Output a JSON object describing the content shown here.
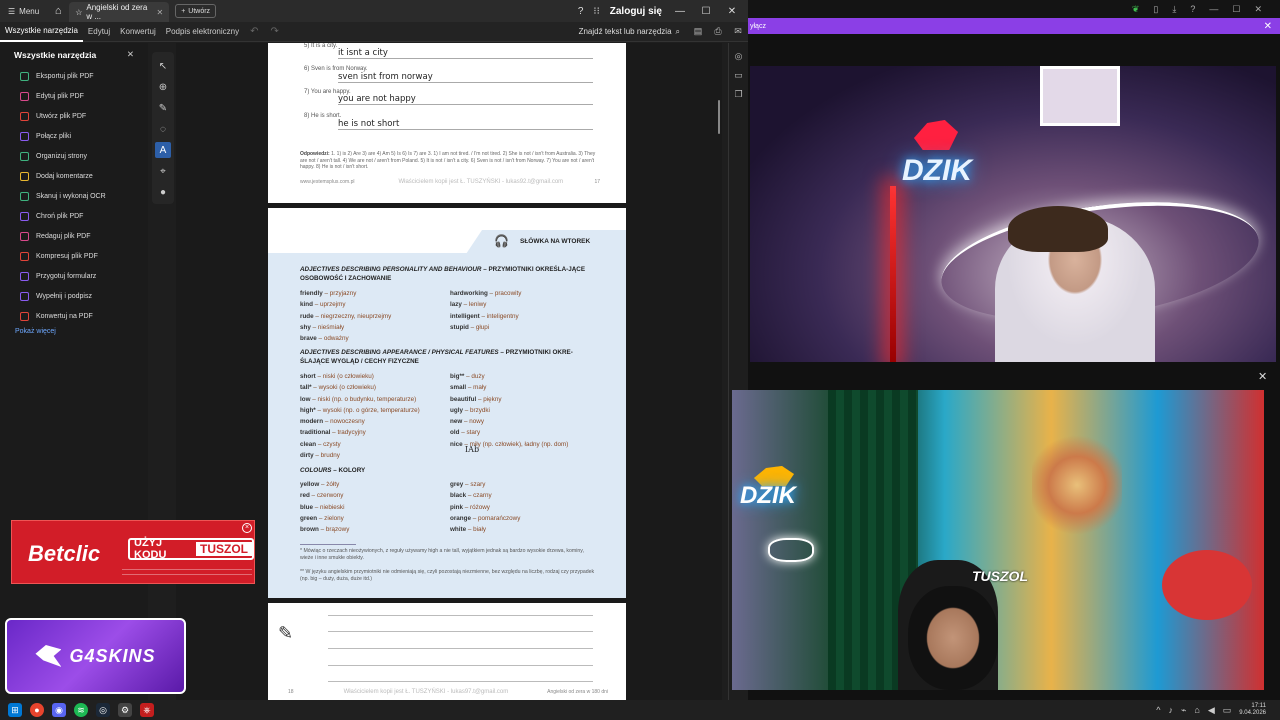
{
  "acrobat": {
    "menu_label": "Menu",
    "tab_title": "Angielski od zera w ...",
    "new_tab_label": "Utwórz",
    "sign_in": "Zaloguj się",
    "toolbar_tabs": [
      "Wszystkie narzędzia",
      "Edytuj",
      "Konwertuj",
      "Podpis elektroniczny"
    ],
    "search_tools": "Znajdź tekst lub narzędzia",
    "tools_panel": {
      "title": "Wszystkie narzędzia",
      "items": [
        {
          "label": "Eksportuj plik PDF",
          "color": "#3fb27f"
        },
        {
          "label": "Edytuj plik PDF",
          "color": "#d94a8c"
        },
        {
          "label": "Utwórz plik PDF",
          "color": "#e0443a"
        },
        {
          "label": "Połącz pliki",
          "color": "#8a5cf0"
        },
        {
          "label": "Organizuj strony",
          "color": "#3fb27f"
        },
        {
          "label": "Dodaj komentarze",
          "color": "#e8b730"
        },
        {
          "label": "Skanuj i wykonaj OCR",
          "color": "#3fb27f"
        },
        {
          "label": "Chroń plik PDF",
          "color": "#8a5cf0"
        },
        {
          "label": "Redaguj plik PDF",
          "color": "#d94a8c"
        },
        {
          "label": "Kompresuj plik PDF",
          "color": "#e0443a"
        },
        {
          "label": "Przygotuj formularz",
          "color": "#8a5cf0"
        },
        {
          "label": "Wypełnij i podpisz",
          "color": "#8a5cf0"
        },
        {
          "label": "Konwertuj na PDF",
          "color": "#e0443a"
        }
      ],
      "show_more": "Pokaż więcej"
    }
  },
  "page1": {
    "exercises": [
      {
        "num": "5)",
        "prompt": "It is a city.",
        "answer": "it isnt a city"
      },
      {
        "num": "6)",
        "prompt": "Sven is from Norway.",
        "answer": "sven isnt from norway"
      },
      {
        "num": "7)",
        "prompt": "You are happy.",
        "answer": "you are not happy"
      },
      {
        "num": "8)",
        "prompt": "He is short.",
        "answer": "he is not short"
      }
    ],
    "answers_label": "Odpowiedzi:",
    "answers_text": "1. 1) is 2) Are 3) are 4) Am 5) Is 6) Is 7) are 3. 1) I am not tired. / I'm not tired. 2) She is not / isn't from Australia. 3) They are not / aren't tall. 4) We are not / aren't from Poland. 5) It is not / isn't a city. 6) Sven is not / isn't from Norway. 7) You are not / aren't happy. 8) He is not / isn't short.",
    "footer_site": "www.jestemsplus.com.pl",
    "watermark": "Właścicielem kopii jest Ł. TUSZYŃSKI - lukas92.t@gmail.com",
    "page_num": "17"
  },
  "page2": {
    "header_title": "SŁÓWKA NA WTOREK",
    "sec1_title_en": "ADJECTIVES DESCRIBING PERSONALITY AND BEHAVIOUR",
    "sec1_title_pl": "– PRZYMIOTNIKI OKREŚLA-JĄCE OSOBOWOŚĆ I ZACHOWANIE",
    "sec1_left": [
      [
        "friendly",
        "przyjazny"
      ],
      [
        "kind",
        "uprzejmy"
      ],
      [
        "rude",
        "niegrzeczny, nieuprzejmy"
      ],
      [
        "shy",
        "nieśmiały"
      ],
      [
        "brave",
        "odważny"
      ]
    ],
    "sec1_right": [
      [
        "hardworking",
        "pracowity"
      ],
      [
        "lazy",
        "leniwy"
      ],
      [
        "intelligent",
        "inteligentny"
      ],
      [
        "stupid",
        "głupi"
      ]
    ],
    "sec2_title_en": "ADJECTIVES DESCRIBING APPEARANCE / PHYSICAL FEATURES",
    "sec2_title_pl": "– PRZYMIOTNIKI OKRE-ŚLAJĄCE WYGLĄD / CECHY FIZYCZNE",
    "sec2_left": [
      [
        "short",
        "niski (o człowieku)"
      ],
      [
        "tall*",
        "wysoki (o człowieku)"
      ],
      [
        "low",
        "niski (np. o budynku, temperaturze)"
      ],
      [
        "high*",
        "wysoki (np. o górze, temperaturze)"
      ],
      [
        "modern",
        "nowoczesny"
      ],
      [
        "traditional",
        "tradycyjny"
      ],
      [
        "clean",
        "czysty"
      ],
      [
        "dirty",
        "brudny"
      ]
    ],
    "sec2_right": [
      [
        "big**",
        "duży"
      ],
      [
        "small",
        "mały"
      ],
      [
        "beautiful",
        "piękny"
      ],
      [
        "ugly",
        "brzydki"
      ],
      [
        "new",
        "nowy"
      ],
      [
        "old",
        "stary"
      ],
      [
        "nice",
        "miły (np. człowiek), ładny (np. dom)"
      ]
    ],
    "sec3_title_en": "COLOURS",
    "sec3_title_pl": "– KOLORY",
    "sec3_left": [
      [
        "yellow",
        "żółty"
      ],
      [
        "red",
        "czerwony"
      ],
      [
        "blue",
        "niebieski"
      ],
      [
        "green",
        "zielony"
      ],
      [
        "brown",
        "brązowy"
      ]
    ],
    "sec3_right": [
      [
        "grey",
        "szary"
      ],
      [
        "black",
        "czarny"
      ],
      [
        "pink",
        "różowy"
      ],
      [
        "orange",
        "pomarańczowy"
      ],
      [
        "white",
        "biały"
      ]
    ],
    "footnote1": "* Mówiąc o rzeczach nieożywionych, z reguły używamy high a nie tall, wyjątkiem jednak są bardzo wysokie drzewa, kominy, wieże i inne smukłe obiekty.",
    "footnote2": "** W języku angielskim przymiotniki nie odmieniają się, czyli pozostają niezmienne, bez względu na liczbę, rodzaj czy przypadek (np. big – duży, duża, duże itd.)"
  },
  "page3": {
    "page_num": "18",
    "watermark": "Właścicielem kopii jest Ł. TUSZYŃSKI - lukas97.t@gmail.com",
    "book_title": "Angielski od zera w 180 dni"
  },
  "overlay": {
    "purple_label": "yłącz",
    "cam1_sign": "DZIK",
    "cam2_sign": "DZIK",
    "cam2_tag": "TUSZOL"
  },
  "ads": {
    "betclic_brand": "Betclic",
    "betclic_code_label": "UŻYJ KODU",
    "betclic_code": "TUSZOL",
    "g4_label": "G4SKINS"
  },
  "taskbar": {
    "time": "17:11",
    "date": "9.04.2026"
  }
}
